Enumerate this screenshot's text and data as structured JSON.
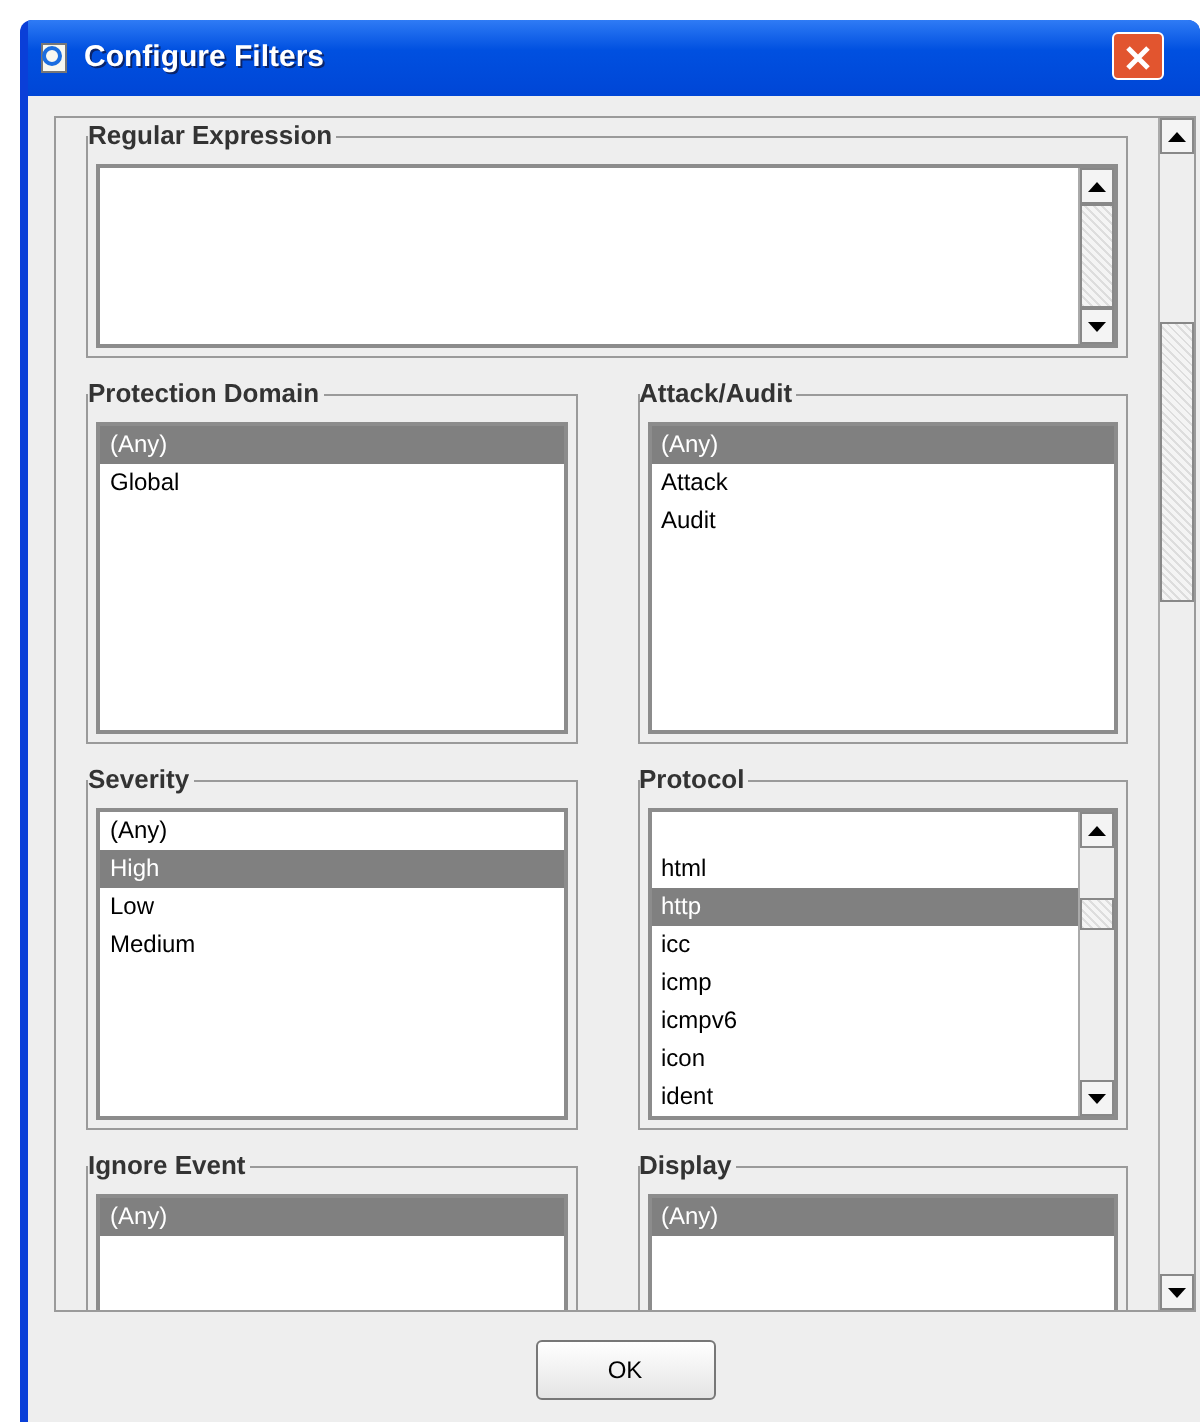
{
  "window": {
    "title": "Configure Filters"
  },
  "regular_expression": {
    "label": "Regular Expression"
  },
  "filters": [
    {
      "label": "Protection Domain",
      "kind": "plain",
      "items": [
        {
          "text": "(Any)",
          "selected": true
        },
        {
          "text": "Global",
          "selected": false
        }
      ]
    },
    {
      "label": "Attack/Audit",
      "kind": "plain",
      "items": [
        {
          "text": "(Any)",
          "selected": true
        },
        {
          "text": "Attack",
          "selected": false
        },
        {
          "text": "Audit",
          "selected": false
        }
      ]
    },
    {
      "label": "Severity",
      "kind": "plain",
      "items": [
        {
          "text": "(Any)",
          "selected": false
        },
        {
          "text": "High",
          "selected": true
        },
        {
          "text": "Low",
          "selected": false
        },
        {
          "text": "Medium",
          "selected": false
        }
      ]
    },
    {
      "label": "Protocol",
      "kind": "scrolling",
      "items": [
        {
          "text": "html",
          "selected": false
        },
        {
          "text": "http",
          "selected": true
        },
        {
          "text": "icc",
          "selected": false
        },
        {
          "text": "icmp",
          "selected": false
        },
        {
          "text": "icmpv6",
          "selected": false
        },
        {
          "text": "icon",
          "selected": false
        },
        {
          "text": "ident",
          "selected": false
        }
      ]
    },
    {
      "label": "Ignore Event",
      "kind": "plain",
      "items": [
        {
          "text": "(Any)",
          "selected": true
        }
      ]
    },
    {
      "label": "Display",
      "kind": "plain",
      "items": [
        {
          "text": "(Any)",
          "selected": true
        }
      ]
    }
  ],
  "buttons": [
    {
      "label": "OK"
    }
  ]
}
